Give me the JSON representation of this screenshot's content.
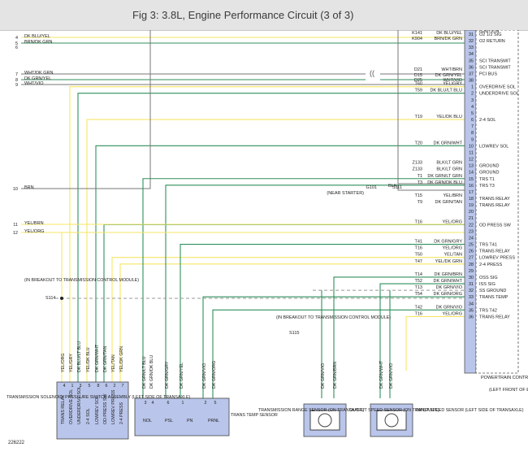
{
  "header": {
    "title": "Fig 3: 3.8L, Engine Performance Circuit (3 of 3)"
  },
  "colors": {
    "yellow": "#f5e663",
    "green": "#2f8f5b",
    "blue": "#7ea3d8",
    "wire": "#777777",
    "connector": "#b9c5ea"
  },
  "pcm": {
    "title": "POWERTRAIN CONTROL MODULE",
    "location": "(LEFT FRONT OF ENGINE COMPT)",
    "top_label": "IGNITION",
    "pins": [
      {
        "n": "31",
        "label": "O2 1/2 SIG"
      },
      {
        "n": "32",
        "label": "O2 RETURN"
      },
      {
        "n": "33",
        "label": ""
      },
      {
        "n": "34",
        "label": ""
      },
      {
        "n": "35",
        "label": "SCI TRANSMIT"
      },
      {
        "n": "36",
        "label": "SCI TRANSMIT"
      },
      {
        "n": "37",
        "label": "PCI BUS"
      },
      {
        "n": "38",
        "label": ""
      },
      {
        "n": "1",
        "label": "OVERDRIVE SOL"
      },
      {
        "n": "2",
        "label": "UNDERDRIVE SOL"
      },
      {
        "n": "3",
        "label": ""
      },
      {
        "n": "4",
        "label": ""
      },
      {
        "n": "5",
        "label": ""
      },
      {
        "n": "6",
        "label": "2-4 SOL"
      },
      {
        "n": "7",
        "label": ""
      },
      {
        "n": "8",
        "label": ""
      },
      {
        "n": "9",
        "label": ""
      },
      {
        "n": "10",
        "label": "LOWREV SOL"
      },
      {
        "n": "11",
        "label": ""
      },
      {
        "n": "12",
        "label": ""
      },
      {
        "n": "13",
        "label": "GROUND"
      },
      {
        "n": "14",
        "label": "GROUND"
      },
      {
        "n": "15",
        "label": "TRS T1"
      },
      {
        "n": "16",
        "label": "TRS T3"
      },
      {
        "n": "17",
        "label": ""
      },
      {
        "n": "18",
        "label": "TRANS RELAY"
      },
      {
        "n": "19",
        "label": "TRANS RELAY"
      },
      {
        "n": "20",
        "label": ""
      },
      {
        "n": "21",
        "label": ""
      },
      {
        "n": "22",
        "label": "OD PRESS SW"
      },
      {
        "n": "23",
        "label": ""
      },
      {
        "n": "24",
        "label": ""
      },
      {
        "n": "25",
        "label": "TRS T41"
      },
      {
        "n": "26",
        "label": "TRANS RELAY"
      },
      {
        "n": "27",
        "label": "LOWREV PRESS"
      },
      {
        "n": "28",
        "label": "2-4 PRESS"
      },
      {
        "n": "29",
        "label": ""
      },
      {
        "n": "30",
        "label": "OSS SIG"
      },
      {
        "n": "31",
        "label": "ISS SIG"
      },
      {
        "n": "32",
        "label": "SS GROUND"
      },
      {
        "n": "33",
        "label": "TRANS TEMP"
      },
      {
        "n": "34",
        "label": ""
      },
      {
        "n": "35",
        "label": "TRS T42"
      },
      {
        "n": "36",
        "label": "TRANS RELAY"
      }
    ]
  },
  "wires": [
    {
      "id": "K141",
      "color": "DK BLU/YEL",
      "pin": "31"
    },
    {
      "id": "K904",
      "color": "BRN/DK GRN",
      "pin": "32"
    },
    {
      "id": "D21",
      "color": "WHT/BRN",
      "pin": "35"
    },
    {
      "id": "D15",
      "color": "DK GRN/YEL",
      "pin": "36"
    },
    {
      "id": "D25",
      "color": "WHT/VIO",
      "pin": "38"
    },
    {
      "id": "T60",
      "color": "YEL/GRY",
      "pin": "1"
    },
    {
      "id": "T59",
      "color": "DK BLU/LT BLU",
      "pin": "2"
    },
    {
      "id": "T19",
      "color": "YEL/DK BLU",
      "pin": "6"
    },
    {
      "id": "T20",
      "color": "DK GRN/WHT",
      "pin": "10"
    },
    {
      "id": "Z133",
      "color": "BLK/LT GRN",
      "pin": "13"
    },
    {
      "id": "Z133",
      "color": "BLK/LT GRN",
      "pin": "14"
    },
    {
      "id": "T1",
      "color": "DK GRN/LT GRN",
      "pin": "15"
    },
    {
      "id": "T3",
      "color": "DK GRN/DK BLU",
      "pin": "16"
    },
    {
      "id": "T15",
      "color": "YEL/BRN",
      "pin": "18"
    },
    {
      "id": "T16",
      "color": "YEL/ORG",
      "pin": "19"
    },
    {
      "id": "T9",
      "color": "DK GRN/TAN",
      "pin": "22"
    },
    {
      "id": "T41",
      "color": "DK GRN/GRY",
      "pin": "25"
    },
    {
      "id": "T16",
      "color": "YEL/ORG",
      "pin": "26"
    },
    {
      "id": "T50",
      "color": "YEL/TAN",
      "pin": "27"
    },
    {
      "id": "T47",
      "color": "YEL/DK GRN",
      "pin": "28"
    },
    {
      "id": "T14",
      "color": "DK GRN/BRN",
      "pin": "30"
    },
    {
      "id": "T52",
      "color": "DK GRN/WHT",
      "pin": "31"
    },
    {
      "id": "T13",
      "color": "DK GRN/VIO",
      "pin": "32"
    },
    {
      "id": "T54",
      "color": "DK GRN/ORG",
      "pin": "33"
    },
    {
      "id": "T42",
      "color": "DK GRN/VIO",
      "pin": "35"
    },
    {
      "id": "T16",
      "color": "YEL/ORG",
      "pin": "36"
    }
  ],
  "left_wires": [
    {
      "n": "4",
      "color": "DK BLU/YEL"
    },
    {
      "n": "5",
      "color": "BRN/DK GRN"
    },
    {
      "n": "6",
      "color": ""
    },
    {
      "n": "7",
      "color": "WHT/DK GRN"
    },
    {
      "n": "8",
      "color": "DK GRN/YEL"
    },
    {
      "n": "9",
      "color": "WHT/VIO"
    },
    {
      "n": "10",
      "color": "BRN"
    },
    {
      "n": "11",
      "color": "YEL/BRN"
    },
    {
      "n": "12",
      "color": "YEL/ORG"
    }
  ],
  "ground": {
    "label": "G101",
    "sub": "(NEAR STARTER)",
    "wire": "BLK",
    "splice1": "S113",
    "splice2": "S111"
  },
  "breakout1": {
    "text": "(IN BREAKOUT TO TRANSMISSION CONTROL MODULE)",
    "splice": "S114"
  },
  "breakout2": {
    "text": "(IN BREAKOUT TO TRANSMISSION CONTROL MODULE)",
    "splice": "S115"
  },
  "solenoid": {
    "title": "TRANSMISSION SOLENOID/ PRESSURE SWITCH ASSEMBLY (LEFT SIDE OF TRANSAXLE)",
    "pins": [
      {
        "n": "4",
        "wire": "YEL/ORG",
        "label": "TRANS RELAY"
      },
      {
        "n": "1",
        "wire": "YEL/GRY",
        "label": "OVERDRIVE SOL"
      },
      {
        "n": "3",
        "wire": "DK BLU/LT BLU",
        "label": "UNDERDRIVE SOL"
      },
      {
        "n": "5",
        "wire": "YEL/DK BLU",
        "label": "2-4 SOL"
      },
      {
        "n": "8",
        "wire": "DK GRN/WHT",
        "label": "LOWREV SOL"
      },
      {
        "n": "6",
        "wire": "DK GRN/TAN",
        "label": "OD PRESS SW"
      },
      {
        "n": "2",
        "wire": "YEL/TAN",
        "label": "LOWREV PRESS"
      },
      {
        "n": "7",
        "wire": "YEL/DK GRN",
        "label": "2-4 PRESS"
      }
    ]
  },
  "range_sensor": {
    "title": "TRANSMISSION RANGE SENSOR (ON TRANSAXLE)",
    "pins": [
      {
        "n": "3",
        "wire": "DK GRN/LT BLU"
      },
      {
        "n": "4",
        "wire": "DK GRN/DK BLU"
      },
      {
        "n": "6",
        "wire": "DK GRN/GRY"
      },
      {
        "n": "1",
        "wire": "DK GRN/YEL"
      },
      {
        "n": "2",
        "wire": "DK GRN/VIO"
      },
      {
        "n": "5",
        "wire": "DK GRN/ORG"
      }
    ],
    "switches": [
      "NOL",
      "PSL",
      "PN",
      "PRNL"
    ],
    "temp": "TRANS TEMP SENSOR"
  },
  "output_sensor": {
    "title": "OUTPUT SPEED SENSOR (ON TRANSAXLE)",
    "pins": [
      {
        "n": "2",
        "wire": "DK GRN/VIO"
      },
      {
        "n": "1",
        "wire": "DK GRN/BRN"
      }
    ]
  },
  "input_sensor": {
    "title": "INPUT SPEED SENSOR (LEFT SIDE OF TRANSAXLE)",
    "pins": [
      {
        "n": "2",
        "wire": "DK GRN/WHT"
      },
      {
        "n": "1",
        "wire": "DK GRN/VIO"
      }
    ]
  },
  "figure_id": "226222"
}
